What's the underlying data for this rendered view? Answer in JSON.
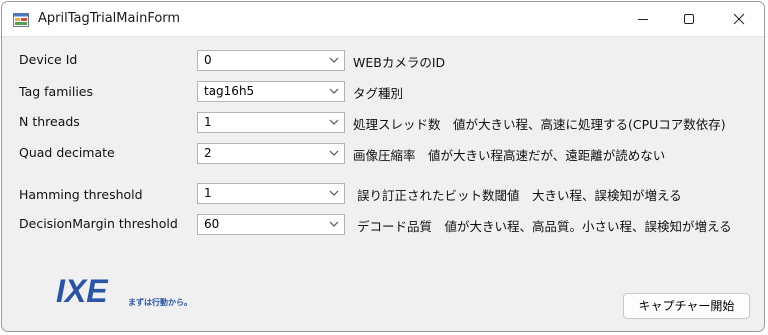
{
  "window": {
    "title": "AprilTagTrialMainForm"
  },
  "form": {
    "rows": [
      {
        "label": "Device Id",
        "value": "0",
        "description": "WEBカメラのID"
      },
      {
        "label": "Tag families",
        "value": "tag16h5",
        "description": "タグ種別"
      },
      {
        "label": "N threads",
        "value": "1",
        "description": "処理スレッド数　値が大きい程、高速に処理する(CPUコア数依存)"
      },
      {
        "label": "Quad decimate",
        "value": "2",
        "description": "画像圧縮率　値が大きい程高速だが、遠距離が読めない"
      },
      {
        "label": "Hamming threshold",
        "value": "1",
        "description": "誤り訂正されたビット数閾値　大きい程、誤検知が増える"
      },
      {
        "label": "DecisionMargin threshold",
        "value": "60",
        "description": "デコード品質　値が大きい程、高品質。小さい程、誤検知が増える"
      }
    ]
  },
  "logo": {
    "text": "IXE",
    "tagline": "まずは行動から。",
    "color": "#2a54a8"
  },
  "start_button": {
    "label": "キャプチャー開始"
  }
}
